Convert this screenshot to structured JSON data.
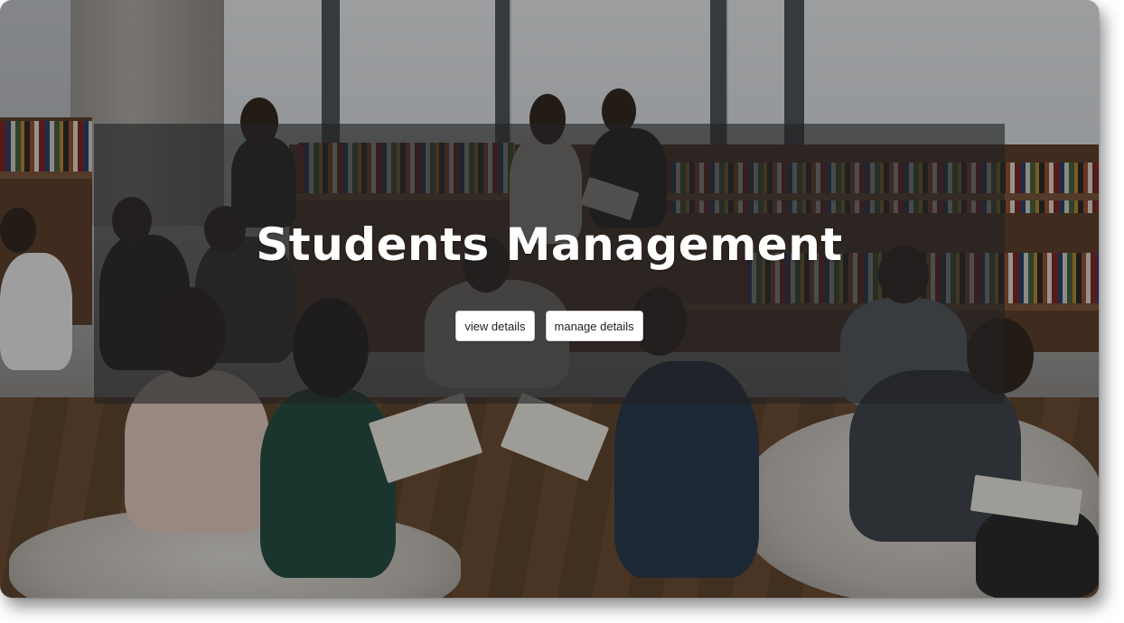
{
  "hero": {
    "title": "Students Management",
    "buttons": {
      "view_label": "view details",
      "manage_label": "manage details"
    }
  },
  "background": {
    "description_icon": "students-in-library-photo"
  },
  "colors": {
    "hero_overlay": "#222224",
    "title_text": "#ffffff",
    "button_bg": "#ffffff",
    "button_text": "#222222"
  }
}
